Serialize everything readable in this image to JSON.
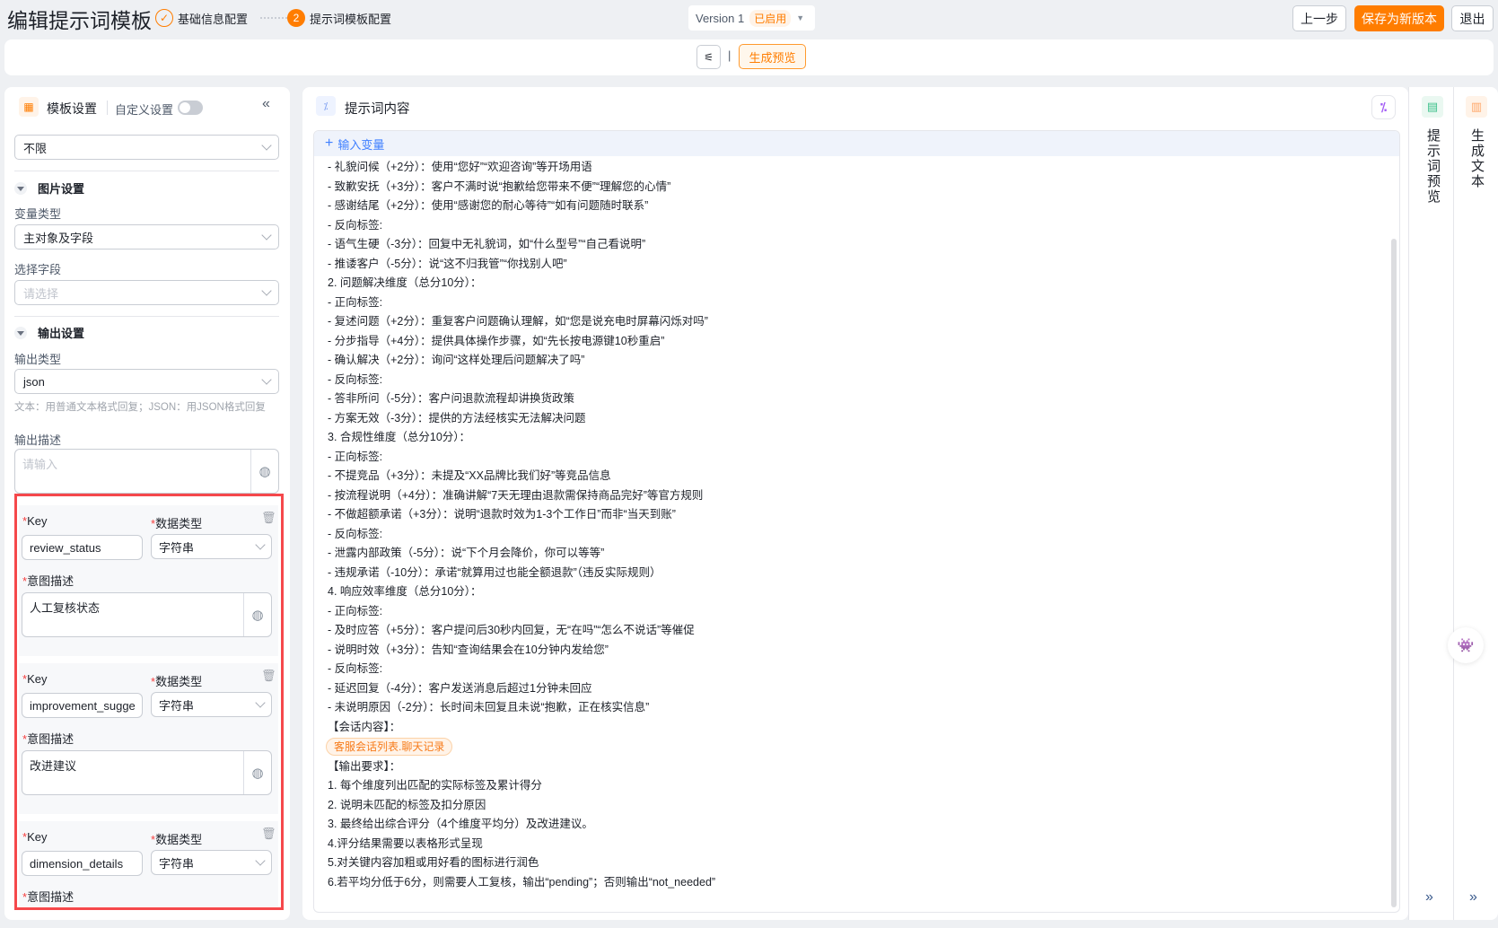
{
  "header": {
    "title": "编辑提示词模板",
    "steps": [
      {
        "label": "基础信息配置",
        "state": "done"
      },
      {
        "label": "提示词模板配置",
        "number": "2",
        "state": "active"
      }
    ],
    "version": "Version 1",
    "version_status": "已启用",
    "prev_button": "上一步",
    "save_button": "保存为新版本",
    "exit_button": "退出"
  },
  "toolbar": {
    "separator": "|",
    "preview_button": "生成预览"
  },
  "left": {
    "title": "模板设置",
    "custom_label": "自定义设置",
    "custom_enabled": false,
    "scope_select": "不限",
    "image_section": {
      "title": "图片设置",
      "var_type_label": "变量类型",
      "var_type_value": "主对象及字段",
      "field_label": "选择字段",
      "field_placeholder": "请选择"
    },
    "output_section": {
      "title": "输出设置",
      "type_label": "输出类型",
      "type_value": "json",
      "hint": "文本：用普通文本格式回复；JSON：用JSON格式回复",
      "desc_label": "输出描述",
      "desc_placeholder": "请输入"
    },
    "fields": [
      {
        "key_label": "Key",
        "type_label": "数据类型",
        "desc_label": "意图描述",
        "key": "review_status",
        "type": "字符串",
        "desc": "人工复核状态"
      },
      {
        "key_label": "Key",
        "type_label": "数据类型",
        "desc_label": "意图描述",
        "key": "improvement_sugge",
        "type": "字符串",
        "desc": "改进建议"
      },
      {
        "key_label": "Key",
        "type_label": "数据类型",
        "desc_label": "意图描述",
        "key": "dimension_details",
        "type": "字符串"
      }
    ]
  },
  "content": {
    "title": "提示词内容",
    "add_variable": "输入变量",
    "lines_before": [
      "- 礼貌问候（+2分）：使用“您好”“欢迎咨询”等开场用语",
      "- 致歉安抚（+3分）：客户不满时说“抱歉给您带来不便”“理解您的心情”",
      "- 感谢结尾（+2分）：使用“感谢您的耐心等待”“如有问题随时联系”",
      "- 反向标签:",
      "- 语气生硬（-3分）：回复中无礼貌词，如“什么型号”“自己看说明”",
      "- 推诿客户（-5分）：说“这不归我管”“你找别人吧”",
      "2. 问题解决维度（总分10分）：",
      "- 正向标签:",
      "- 复述问题（+2分）：重复客户问题确认理解，如“您是说充电时屏幕闪烁对吗”",
      "- 分步指导（+4分）：提供具体操作步骤，如“先长按电源键10秒重启”",
      "- 确认解决（+2分）：询问“这样处理后问题解决了吗”",
      "- 反向标签:",
      "- 答非所问（-5分）：客户问退款流程却讲换货政策",
      "- 方案无效（-3分）：提供的方法经核实无法解决问题",
      "3. 合规性维度（总分10分）：",
      "- 正向标签:",
      "- 不提竞品（+3分）：未提及“XX品牌比我们好”等竞品信息",
      "- 按流程说明（+4分）：准确讲解“7天无理由退款需保持商品完好”等官方规则",
      "- 不做超额承诺（+3分）：说明“退款时效为1-3个工作日”而非“当天到账”",
      "- 反向标签:",
      "- 泄露内部政策（-5分）：说“下个月会降价，你可以等等”",
      "- 违规承诺（-10分）：承诺“就算用过也能全额退款”（违反实际规则）",
      "4. 响应效率维度（总分10分）：",
      "- 正向标签:",
      "- 及时应答（+5分）：客户提问后30秒内回复，无“在吗”“怎么不说话”等催促",
      "- 说明时效（+3分）：告知“查询结果会在10分钟内发给您”",
      "- 反向标签:",
      "- 延迟回复（-4分）：客户发送消息后超过1分钟未回应",
      "- 未说明原因（-2分）：长时间未回复且未说“抱歉，正在核实信息”",
      "【会话内容】："
    ],
    "variable_tag": "客服会话列表.聊天记录",
    "lines_after": [
      "【输出要求】：",
      "1. 每个维度列出匹配的实际标签及累计得分",
      "2. 说明未匹配的标签及扣分原因",
      "3. 最终给出综合评分（4个维度平均分）及改进建议。",
      "4.评分结果需要以表格形式呈现",
      "5.对关键内容加粗或用好看的图标进行润色",
      "6.若平均分低于6分，则需要人工复核，输出“pending”；否则输出“not_needed”"
    ]
  },
  "side": {
    "prompt_preview": "提示词预览",
    "generate_text": "生成文本"
  },
  "colors": {
    "accent": "#ff7d00",
    "danger": "#f53f3f",
    "link": "#4080ff"
  }
}
